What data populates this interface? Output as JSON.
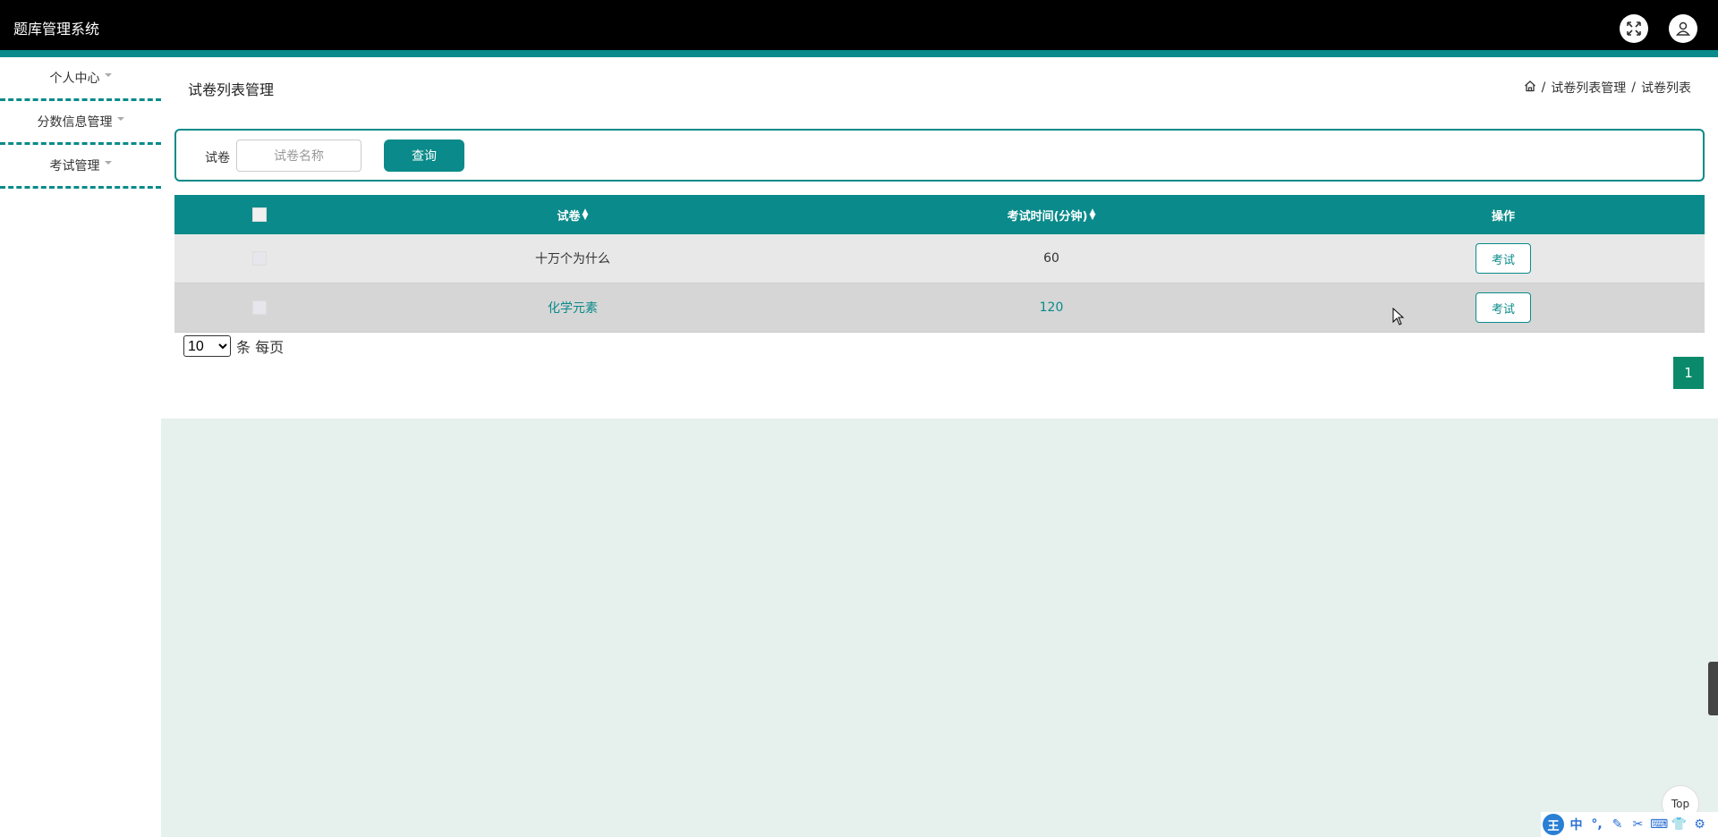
{
  "header": {
    "app_title": "题库管理系统",
    "icons": [
      "fullscreen-icon",
      "user-icon"
    ]
  },
  "sidebar": {
    "items": [
      {
        "label": "个人中心"
      },
      {
        "label": "分数信息管理"
      },
      {
        "label": "考试管理"
      }
    ]
  },
  "page": {
    "title": "试卷列表管理",
    "breadcrumb": [
      "试卷列表管理",
      "试卷列表"
    ]
  },
  "search": {
    "label": "试卷",
    "placeholder": "试卷名称",
    "value": "",
    "button_label": "查询"
  },
  "table": {
    "columns": [
      "试卷",
      "考试时间(分钟)",
      "操作"
    ],
    "rows": [
      {
        "name": "十万个为什么",
        "time": "60",
        "action": "考试"
      },
      {
        "name": "化学元素",
        "time": "120",
        "action": "考试"
      }
    ]
  },
  "pagination": {
    "page_size": "10",
    "page_size_options": [
      "10"
    ],
    "page_size_suffix": "条 每页",
    "current_page": "1"
  },
  "back_to_top": "Top",
  "ime_toolbar": {
    "logo": "王",
    "items": [
      "中",
      "°,",
      "✎",
      "✂",
      "⌨",
      "👕",
      "⚙"
    ]
  },
  "colors": {
    "accent": "#0a8a8a",
    "header_bg": "#000000",
    "content_bg": "#e6f0ed"
  }
}
